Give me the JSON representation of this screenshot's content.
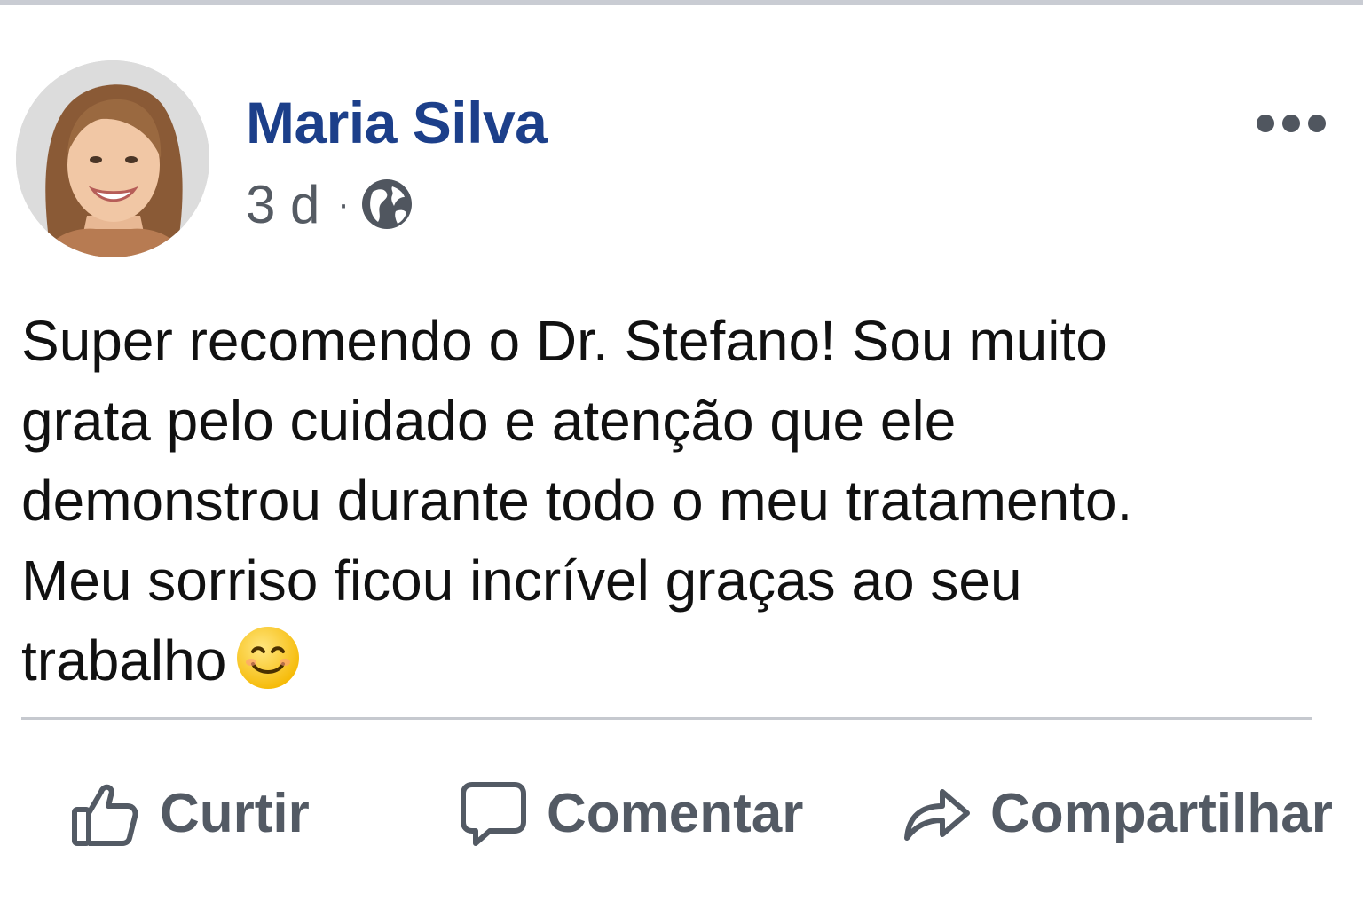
{
  "post": {
    "author_name": "Maria Silva",
    "timestamp": "3 d",
    "separator": "·",
    "audience_icon": "globe-icon",
    "text_lines": [
      "Super recomendo o Dr. Stefano! Sou muito",
      "grata pelo cuidado e atenção que ele",
      "demonstrou durante todo o meu tratamento.",
      "Meu sorriso ficou incrível graças ao seu",
      "trabalho"
    ],
    "emoji_icon": "smiling-face-icon"
  },
  "actions": {
    "like": {
      "label": "Curtir",
      "icon": "thumbs-up-icon"
    },
    "comment": {
      "label": "Comentar",
      "icon": "speech-bubble-icon"
    },
    "share": {
      "label": "Compartilhar",
      "icon": "share-arrow-icon"
    }
  },
  "colors": {
    "author_name": "#1c3f8a",
    "meta_text": "#555b63",
    "action_text": "#535a64",
    "divider": "#c6c9cf",
    "body_text": "#111111"
  }
}
